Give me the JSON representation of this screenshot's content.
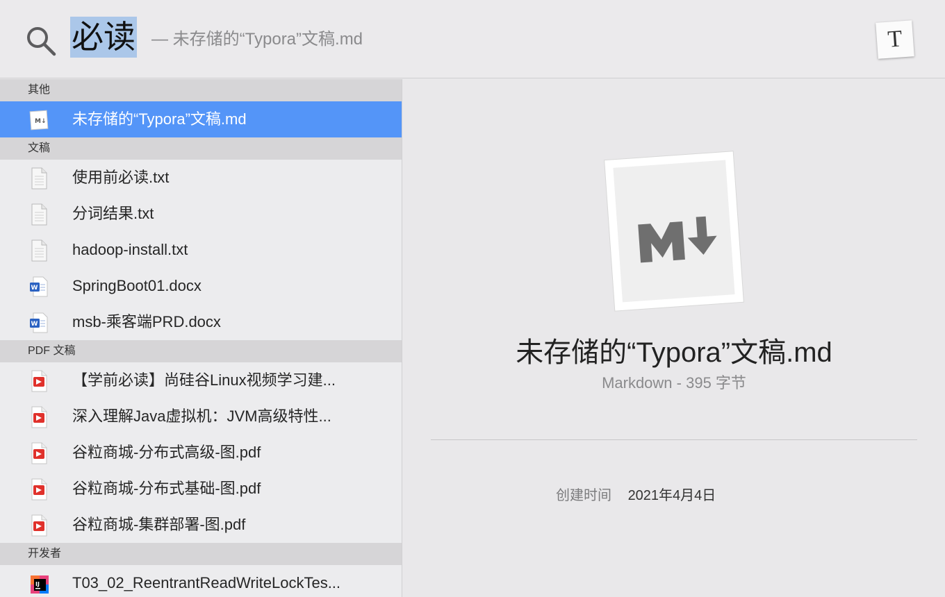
{
  "search": {
    "query": "必读",
    "completion": "— 未存储的“Typora”文稿.md",
    "app_icon_letter": "T"
  },
  "sections": [
    {
      "header": "其他",
      "items": [
        {
          "label": "未存储的“Typora”文稿.md",
          "icon": "markdown-icon",
          "selected": true
        }
      ]
    },
    {
      "header": "文稿",
      "items": [
        {
          "label": "使用前必读.txt",
          "icon": "text-file-icon"
        },
        {
          "label": "分词结果.txt",
          "icon": "text-file-icon"
        },
        {
          "label": "hadoop-install.txt",
          "icon": "text-file-icon"
        },
        {
          "label": "SpringBoot01.docx",
          "icon": "word-doc-icon"
        },
        {
          "label": "msb-乘客端PRD.docx",
          "icon": "word-doc-icon"
        }
      ]
    },
    {
      "header": "PDF 文稿",
      "items": [
        {
          "label": "【学前必读】尚硅谷Linux视频学习建...",
          "icon": "pdf-icon"
        },
        {
          "label": "深入理解Java虚拟机：JVM高级特性...",
          "icon": "pdf-icon"
        },
        {
          "label": "谷粒商城-分布式高级-图.pdf",
          "icon": "pdf-icon"
        },
        {
          "label": "谷粒商城-分布式基础-图.pdf",
          "icon": "pdf-icon"
        },
        {
          "label": "谷粒商城-集群部署-图.pdf",
          "icon": "pdf-icon"
        }
      ]
    },
    {
      "header": "开发者",
      "items": [
        {
          "label": "T03_02_ReentrantReadWriteLockTes...",
          "icon": "intellij-icon"
        }
      ]
    }
  ],
  "preview": {
    "title": "未存储的“Typora”文稿.md",
    "subtitle": "Markdown - 395 字节",
    "created_label": "创建时间",
    "created_value": "2021年4月4日"
  },
  "colors": {
    "selection": "#5495f8",
    "query_highlight": "#abc7e9",
    "pdf_red": "#e0312b",
    "word_blue": "#2b62c2"
  }
}
